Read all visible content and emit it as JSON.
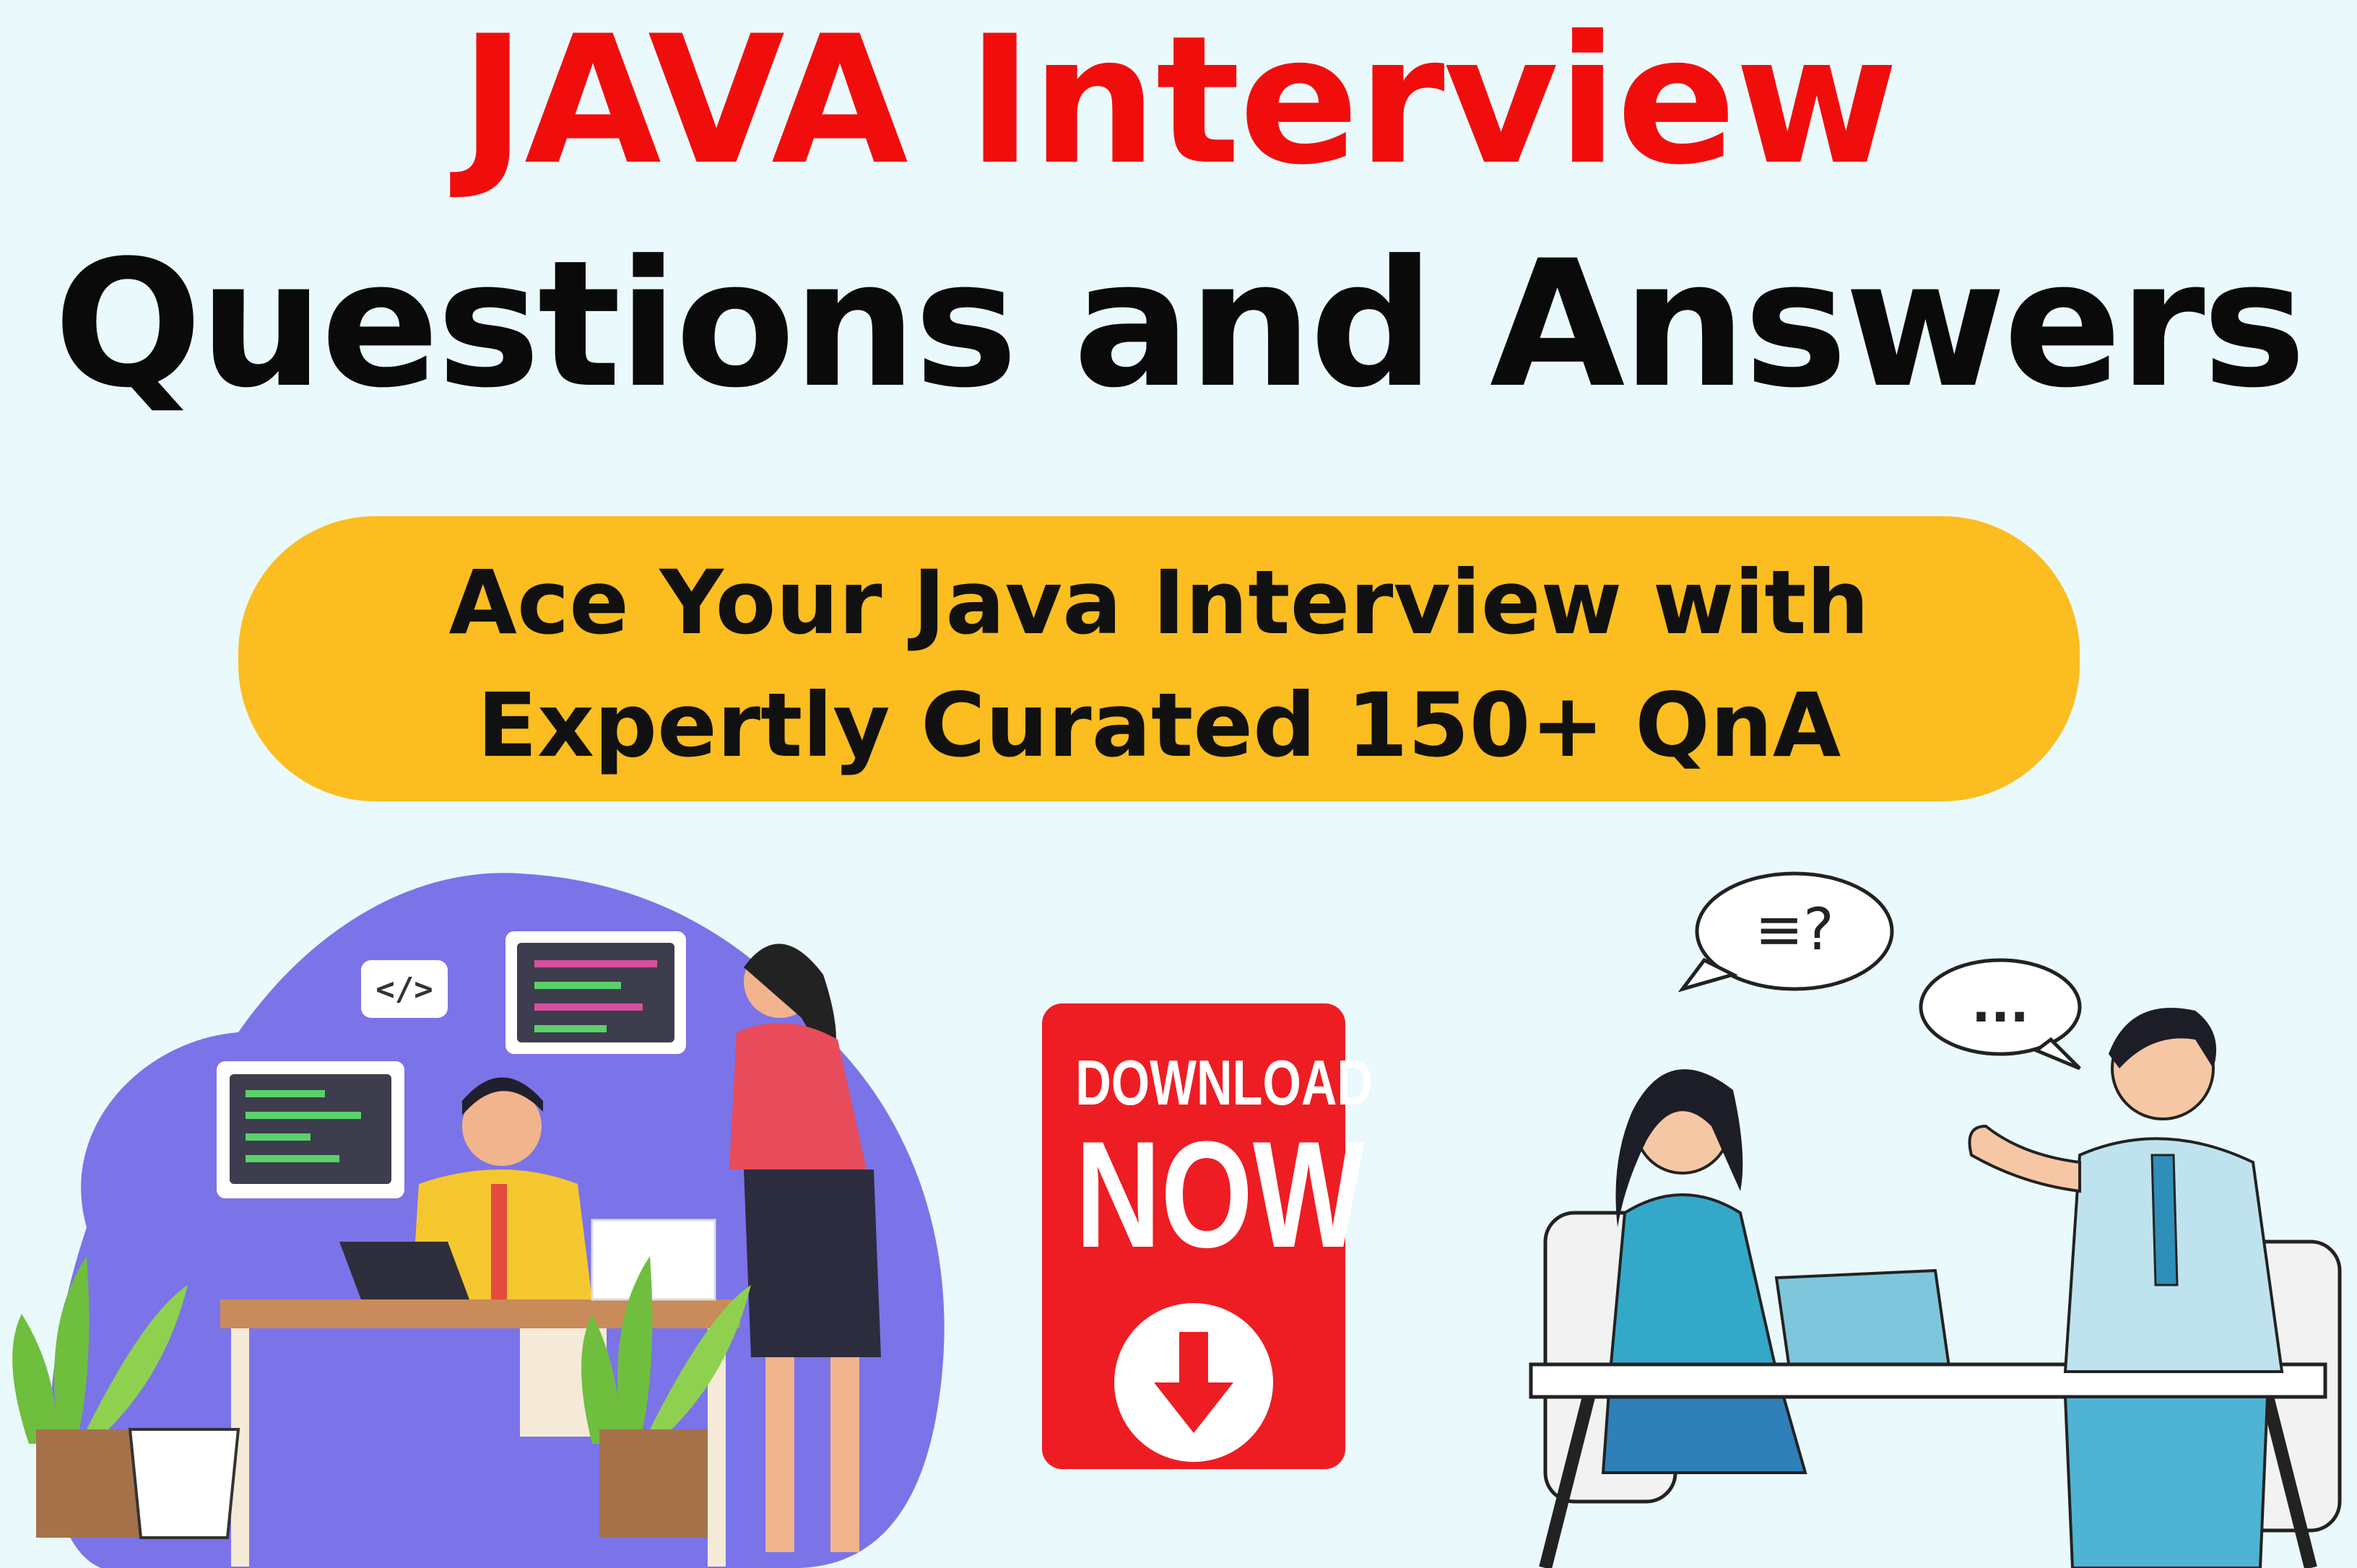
{
  "title": {
    "line1": "JAVA Interview",
    "line2": "Questions and Answers"
  },
  "tagline": {
    "line1": "Ace Your Java Interview with",
    "line2": "Expertly Curated 150+ QnA"
  },
  "download_badge": {
    "line1": "DOWNLOAD",
    "line2": "NOW",
    "icon": "arrow-down-icon"
  },
  "illustrations": {
    "left": "office-coding-scene",
    "right": "interview-conversation-scene",
    "code_tag": "</>",
    "speech_bubble_1": "≡?",
    "speech_bubble_2": "..."
  },
  "colors": {
    "title_red": "#f20d0d",
    "pill_yellow": "#fbbd1f",
    "badge_red": "#ee1d23",
    "background": "#eaf9fb",
    "blob_purple": "#7b73e8"
  }
}
